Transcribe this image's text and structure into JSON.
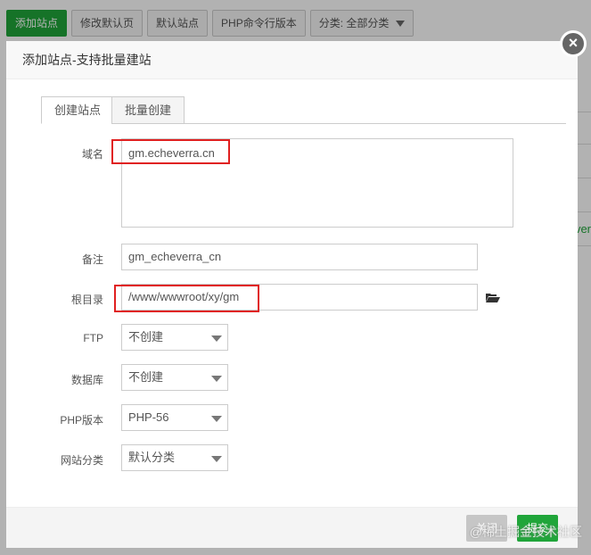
{
  "toolbar": {
    "add_site": "添加站点",
    "modify_default_page": "修改默认页",
    "default_site": "默认站点",
    "php_cli_version": "PHP命令行版本",
    "category": "分类: 全部分类"
  },
  "background": {
    "partial_text": "ver"
  },
  "modal": {
    "title": "添加站点-支持批量建站",
    "tabs": [
      "创建站点",
      "批量创建"
    ],
    "domain_label": "域名",
    "domain_value": "gm.echeverra.cn",
    "remark_label": "备注",
    "remark_value": "gm_echeverra_cn",
    "root_label": "根目录",
    "root_value": "/www/wwwroot/xy/gm",
    "ftp_label": "FTP",
    "ftp_value": "不创建",
    "db_label": "数据库",
    "db_value": "不创建",
    "php_label": "PHP版本",
    "php_value": "PHP-56",
    "category_label": "网站分类",
    "category_value": "默认分类",
    "close_button": "关闭",
    "submit_button": "提交"
  },
  "watermark": "@稀土掘金技术社区"
}
